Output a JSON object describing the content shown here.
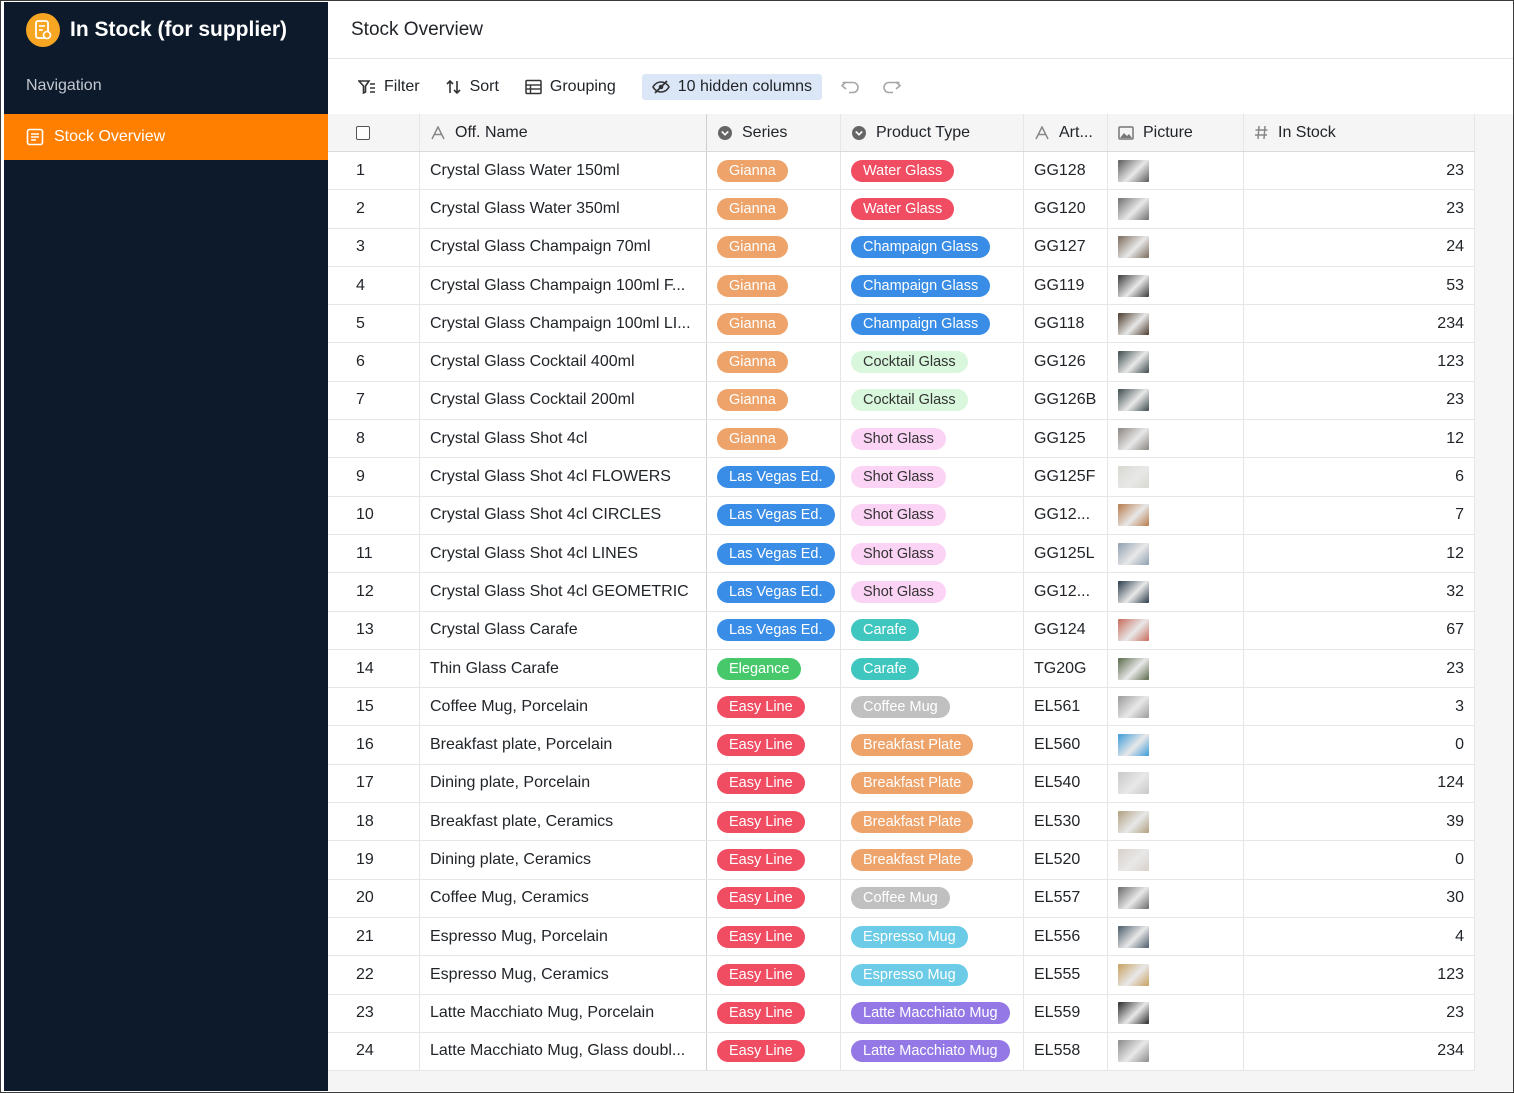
{
  "app": {
    "title": "In Stock (for supplier)"
  },
  "sidebar": {
    "nav_label": "Navigation",
    "items": [
      {
        "label": "Stock Overview",
        "active": true
      }
    ]
  },
  "page": {
    "title": "Stock Overview"
  },
  "toolbar": {
    "filter": "Filter",
    "sort": "Sort",
    "grouping": "Grouping",
    "hidden_columns": "10 hidden columns"
  },
  "columns": {
    "name": "Off. Name",
    "series": "Series",
    "type": "Product Type",
    "art": "Art...",
    "picture": "Picture",
    "stock": "In Stock"
  },
  "colors": {
    "accent": "#ff8000",
    "sidebar_bg": "#0c1a2b",
    "series": {
      "Gianna": "#eda36a",
      "Las Vegas Ed.": "#3a8de6",
      "Elegance": "#47c96b",
      "Easy Line": "#f04c62"
    },
    "types": {
      "Water Glass": {
        "bg": "#f04c62",
        "fg": "#ffffff"
      },
      "Champaign Glass": {
        "bg": "#3a8de6",
        "fg": "#ffffff"
      },
      "Cocktail Glass": {
        "bg": "#d8f7dc",
        "fg": "#333333"
      },
      "Shot Glass": {
        "bg": "#fbd3f4",
        "fg": "#333333"
      },
      "Carafe": {
        "bg": "#3fc7bf",
        "fg": "#ffffff"
      },
      "Coffee Mug": {
        "bg": "#c0c0c0",
        "fg": "#ffffff"
      },
      "Breakfast Plate": {
        "bg": "#eda36a",
        "fg": "#ffffff"
      },
      "Espresso Mug": {
        "bg": "#6ccbe6",
        "fg": "#ffffff"
      },
      "Latte Macchiato Mug": {
        "bg": "#9479e6",
        "fg": "#ffffff"
      }
    }
  },
  "rows": [
    {
      "id": "1",
      "name": "Crystal Glass Water 150ml",
      "series": "Gianna",
      "type": "Water Glass",
      "art": "GG128",
      "pic": "#5a5a5a",
      "stock": "23"
    },
    {
      "id": "2",
      "name": "Crystal Glass Water 350ml",
      "series": "Gianna",
      "type": "Water Glass",
      "art": "GG120",
      "pic": "#6f6f6f",
      "stock": "23"
    },
    {
      "id": "3",
      "name": "Crystal Glass Champaign 70ml",
      "series": "Gianna",
      "type": "Champaign Glass",
      "art": "GG127",
      "pic": "#7a6a5a",
      "stock": "24"
    },
    {
      "id": "4",
      "name": "Crystal Glass Champaign 100ml F...",
      "series": "Gianna",
      "type": "Champaign Glass",
      "art": "GG119",
      "pic": "#3a3a3a",
      "stock": "53"
    },
    {
      "id": "5",
      "name": "Crystal Glass Champaign 100ml LI...",
      "series": "Gianna",
      "type": "Champaign Glass",
      "art": "GG118",
      "pic": "#4a3a2a",
      "stock": "234"
    },
    {
      "id": "6",
      "name": "Crystal Glass Cocktail 400ml",
      "series": "Gianna",
      "type": "Cocktail Glass",
      "art": "GG126",
      "pic": "#3c4a4c",
      "stock": "123"
    },
    {
      "id": "7",
      "name": "Crystal Glass Cocktail 200ml",
      "series": "Gianna",
      "type": "Cocktail Glass",
      "art": "GG126B",
      "pic": "#3c4a4c",
      "stock": "23"
    },
    {
      "id": "8",
      "name": "Crystal Glass Shot 4cl",
      "series": "Gianna",
      "type": "Shot Glass",
      "art": "GG125",
      "pic": "#8a8580",
      "stock": "12"
    },
    {
      "id": "9",
      "name": "Crystal Glass Shot 4cl FLOWERS",
      "series": "Las Vegas Ed.",
      "type": "Shot Glass",
      "art": "GG125F",
      "pic": "#d8d8d0",
      "stock": "6"
    },
    {
      "id": "10",
      "name": "Crystal Glass Shot 4cl CIRCLES",
      "series": "Las Vegas Ed.",
      "type": "Shot Glass",
      "art": "GG12...",
      "pic": "#b87a4a",
      "stock": "7"
    },
    {
      "id": "11",
      "name": "Crystal Glass Shot 4cl LINES",
      "series": "Las Vegas Ed.",
      "type": "Shot Glass",
      "art": "GG125L",
      "pic": "#8fa0b0",
      "stock": "12"
    },
    {
      "id": "12",
      "name": "Crystal Glass Shot 4cl GEOMETRIC",
      "series": "Las Vegas Ed.",
      "type": "Shot Glass",
      "art": "GG12...",
      "pic": "#2a3a4a",
      "stock": "32"
    },
    {
      "id": "13",
      "name": "Crystal Glass Carafe",
      "series": "Las Vegas Ed.",
      "type": "Carafe",
      "art": "GG124",
      "pic": "#c86a5a",
      "stock": "67"
    },
    {
      "id": "14",
      "name": "Thin Glass Carafe",
      "series": "Elegance",
      "type": "Carafe",
      "art": "TG20G",
      "pic": "#5a6a4a",
      "stock": "23"
    },
    {
      "id": "15",
      "name": "Coffee Mug, Porcelain",
      "series": "Easy Line",
      "type": "Coffee Mug",
      "art": "EL561",
      "pic": "#9a9a9a",
      "stock": "3"
    },
    {
      "id": "16",
      "name": "Breakfast plate, Porcelain",
      "series": "Easy Line",
      "type": "Breakfast Plate",
      "art": "EL560",
      "pic": "#3a9ad8",
      "stock": "0"
    },
    {
      "id": "17",
      "name": "Dining plate, Porcelain",
      "series": "Easy Line",
      "type": "Breakfast Plate",
      "art": "EL540",
      "pic": "#c8c8c8",
      "stock": "124"
    },
    {
      "id": "18",
      "name": "Breakfast plate, Ceramics",
      "series": "Easy Line",
      "type": "Breakfast Plate",
      "art": "EL530",
      "pic": "#b0a080",
      "stock": "39"
    },
    {
      "id": "19",
      "name": "Dining plate, Ceramics",
      "series": "Easy Line",
      "type": "Breakfast Plate",
      "art": "EL520",
      "pic": "#d8d0c8",
      "stock": "0"
    },
    {
      "id": "20",
      "name": "Coffee Mug, Ceramics",
      "series": "Easy Line",
      "type": "Coffee Mug",
      "art": "EL557",
      "pic": "#6a6a6a",
      "stock": "30"
    },
    {
      "id": "21",
      "name": "Espresso Mug, Porcelain",
      "series": "Easy Line",
      "type": "Espresso Mug",
      "art": "EL556",
      "pic": "#4a5a6a",
      "stock": "4"
    },
    {
      "id": "22",
      "name": "Espresso Mug, Ceramics",
      "series": "Easy Line",
      "type": "Espresso Mug",
      "art": "EL555",
      "pic": "#c8a060",
      "stock": "123"
    },
    {
      "id": "23",
      "name": "Latte Macchiato Mug, Porcelain",
      "series": "Easy Line",
      "type": "Latte Macchiato Mug",
      "art": "EL559",
      "pic": "#2a2a2a",
      "stock": "23"
    },
    {
      "id": "24",
      "name": "Latte Macchiato Mug, Glass doubl...",
      "series": "Easy Line",
      "type": "Latte Macchiato Mug",
      "art": "EL558",
      "pic": "#8a8a8a",
      "stock": "234"
    }
  ]
}
